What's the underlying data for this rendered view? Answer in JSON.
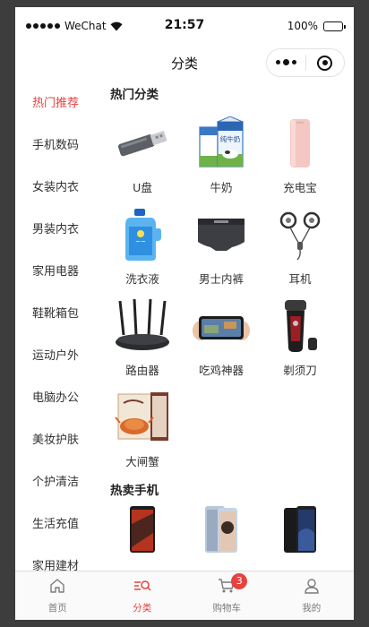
{
  "status_bar": {
    "carrier": "WeChat",
    "time": "21:57",
    "battery": "100%"
  },
  "nav": {
    "title": "分类"
  },
  "sidebar": {
    "items": [
      {
        "label": "热门推荐"
      },
      {
        "label": "手机数码"
      },
      {
        "label": "女装内衣"
      },
      {
        "label": "男装内衣"
      },
      {
        "label": "家用电器"
      },
      {
        "label": "鞋靴箱包"
      },
      {
        "label": "运动户外"
      },
      {
        "label": "电脑办公"
      },
      {
        "label": "美妆护肤"
      },
      {
        "label": "个护清洁"
      },
      {
        "label": "生活充值"
      },
      {
        "label": "家用建材"
      }
    ]
  },
  "sections": {
    "hot": {
      "title": "热门分类",
      "items": [
        {
          "label": "U盘",
          "icon": "usb-drive-icon"
        },
        {
          "label": "牛奶",
          "icon": "milk-carton-icon",
          "carton_text": "纯牛奶"
        },
        {
          "label": "充电宝",
          "icon": "power-bank-icon"
        },
        {
          "label": "洗衣液",
          "icon": "detergent-bottle-icon"
        },
        {
          "label": "男士内裤",
          "icon": "underwear-icon"
        },
        {
          "label": "耳机",
          "icon": "earphones-icon"
        },
        {
          "label": "路由器",
          "icon": "router-icon"
        },
        {
          "label": "吃鸡神器",
          "icon": "phone-game-controller-icon"
        },
        {
          "label": "剃须刀",
          "icon": "shaver-icon"
        },
        {
          "label": "大闸蟹",
          "icon": "crab-gift-box-icon"
        }
      ]
    },
    "phones": {
      "title": "热卖手机",
      "items": [
        {
          "icon": "phone-image-icon"
        },
        {
          "icon": "phone-image-icon"
        },
        {
          "icon": "phone-image-icon"
        }
      ]
    }
  },
  "tabbar": {
    "items": [
      {
        "label": "首页",
        "icon": "home-icon"
      },
      {
        "label": "分类",
        "icon": "category-icon"
      },
      {
        "label": "购物车",
        "icon": "cart-icon",
        "badge": "3"
      },
      {
        "label": "我的",
        "icon": "user-icon"
      }
    ]
  },
  "colors": {
    "accent": "#e64340",
    "frame": "#3d3d3d"
  }
}
